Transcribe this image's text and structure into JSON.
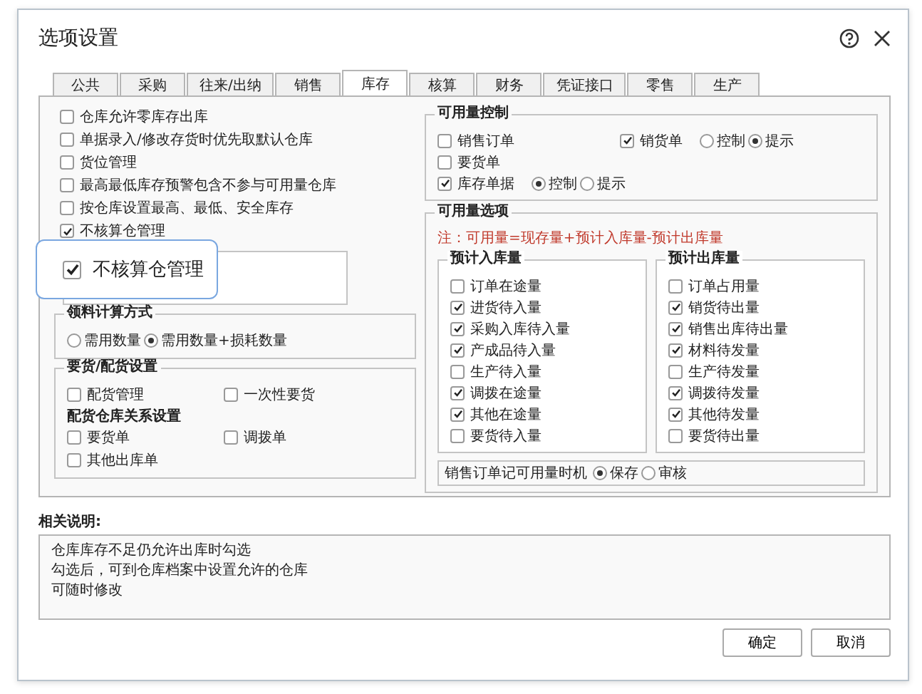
{
  "window": {
    "title": "选项设置"
  },
  "tabs": [
    {
      "label": "公共",
      "selected": false
    },
    {
      "label": "采购",
      "selected": false
    },
    {
      "label": "往来/出纳",
      "selected": false
    },
    {
      "label": "销售",
      "selected": false
    },
    {
      "label": "库存",
      "selected": true
    },
    {
      "label": "核算",
      "selected": false
    },
    {
      "label": "财务",
      "selected": false
    },
    {
      "label": "凭证接口",
      "selected": false
    },
    {
      "label": "零售",
      "selected": false
    },
    {
      "label": "生产",
      "selected": false
    }
  ],
  "inventory_options": [
    {
      "label": "仓库允许零库存出库",
      "checked": false
    },
    {
      "label": "单据录入/修改存货时优先取默认仓库",
      "checked": false
    },
    {
      "label": "货位管理",
      "checked": false
    },
    {
      "label": "最高最低库存预警包含不参与可用量仓库",
      "checked": false
    },
    {
      "label": "按仓库设置最高、最低、安全库存",
      "checked": false
    },
    {
      "label": "不核算仓管理",
      "checked": true
    }
  ],
  "magnifier_callout": {
    "label": "不核算仓管理",
    "checked": true
  },
  "material_calc": {
    "title": "领料计算方式",
    "options": [
      {
        "label": "需用数量",
        "selected": false
      },
      {
        "label": "需用数量+损耗数量",
        "selected": true
      }
    ]
  },
  "requisition": {
    "title": "要货/配货设置",
    "options": [
      {
        "label": "配货管理",
        "checked": false
      },
      {
        "label": "一次性要货",
        "checked": false
      }
    ],
    "subtitle": "配货仓库关系设置",
    "relations": [
      {
        "label": "要货单",
        "checked": false
      },
      {
        "label": "调拨单",
        "checked": false
      },
      {
        "label": "其他出库单",
        "checked": false
      }
    ]
  },
  "availability_control": {
    "title": "可用量控制",
    "rows": [
      [
        {
          "label": "销售订单",
          "checked": false
        },
        {
          "label": "销货单",
          "checked": true,
          "modes": [
            {
              "label": "控制",
              "selected": false
            },
            {
              "label": "提示",
              "selected": true
            }
          ]
        }
      ],
      [
        {
          "label": "要货单",
          "checked": false
        }
      ],
      [
        {
          "label": "库存单据",
          "checked": true,
          "modes": [
            {
              "label": "控制",
              "selected": true
            },
            {
              "label": "提示",
              "selected": false
            }
          ]
        }
      ]
    ]
  },
  "availability_options": {
    "title": "可用量选项",
    "note": "注：可用量=现存量+预计入库量-预计出库量",
    "incoming": {
      "title": "预计入库量",
      "items": [
        {
          "label": "订单在途量",
          "checked": false
        },
        {
          "label": "进货待入量",
          "checked": true
        },
        {
          "label": "采购入库待入量",
          "checked": true
        },
        {
          "label": "产成品待入量",
          "checked": true
        },
        {
          "label": "生产待入量",
          "checked": false
        },
        {
          "label": "调拨在途量",
          "checked": true
        },
        {
          "label": "其他在途量",
          "checked": true
        },
        {
          "label": "要货待入量",
          "checked": false
        }
      ]
    },
    "outgoing": {
      "title": "预计出库量",
      "items": [
        {
          "label": "订单占用量",
          "checked": false
        },
        {
          "label": "销货待出量",
          "checked": true
        },
        {
          "label": "销售出库待出量",
          "checked": true
        },
        {
          "label": "材料待发量",
          "checked": true
        },
        {
          "label": "生产待发量",
          "checked": false
        },
        {
          "label": "调拨待发量",
          "checked": true
        },
        {
          "label": "其他待发量",
          "checked": true
        },
        {
          "label": "要货待出量",
          "checked": false
        }
      ]
    },
    "timing": {
      "label": "销售订单记可用量时机",
      "options": [
        {
          "label": "保存",
          "selected": true
        },
        {
          "label": "审核",
          "selected": false
        }
      ]
    }
  },
  "description": {
    "title": "相关说明:",
    "lines": [
      "仓库库存不足仍允许出库时勾选",
      "勾选后，可到仓库档案中设置允许的仓库",
      "可随时修改"
    ]
  },
  "buttons": [
    "确定",
    "取消"
  ]
}
